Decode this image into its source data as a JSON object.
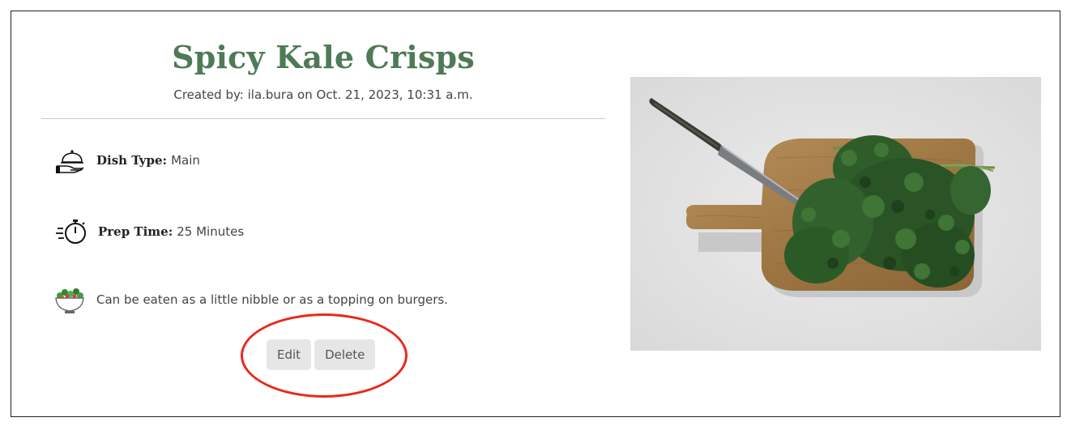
{
  "recipe": {
    "title": "Spicy Kale Crisps",
    "meta": "Created by: ila.bura on Oct. 21, 2023, 10:31 a.m.",
    "dish_type": {
      "label": "Dish Type:",
      "value": "Main",
      "icon": "serving-cloche-icon"
    },
    "prep_time": {
      "label": "Prep Time:",
      "value": "25 Minutes",
      "icon": "stopwatch-icon"
    },
    "description": {
      "text": "Can be eaten as a little nibble or as a topping on burgers.",
      "icon": "salad-bowl-icon"
    }
  },
  "actions": {
    "edit_label": "Edit",
    "delete_label": "Delete"
  },
  "image": {
    "subject": "kale on cutting board with knife"
  },
  "colors": {
    "title_green": "#4e7a56",
    "annotation_red": "#e8291c",
    "button_bg": "#e6e6e6"
  }
}
